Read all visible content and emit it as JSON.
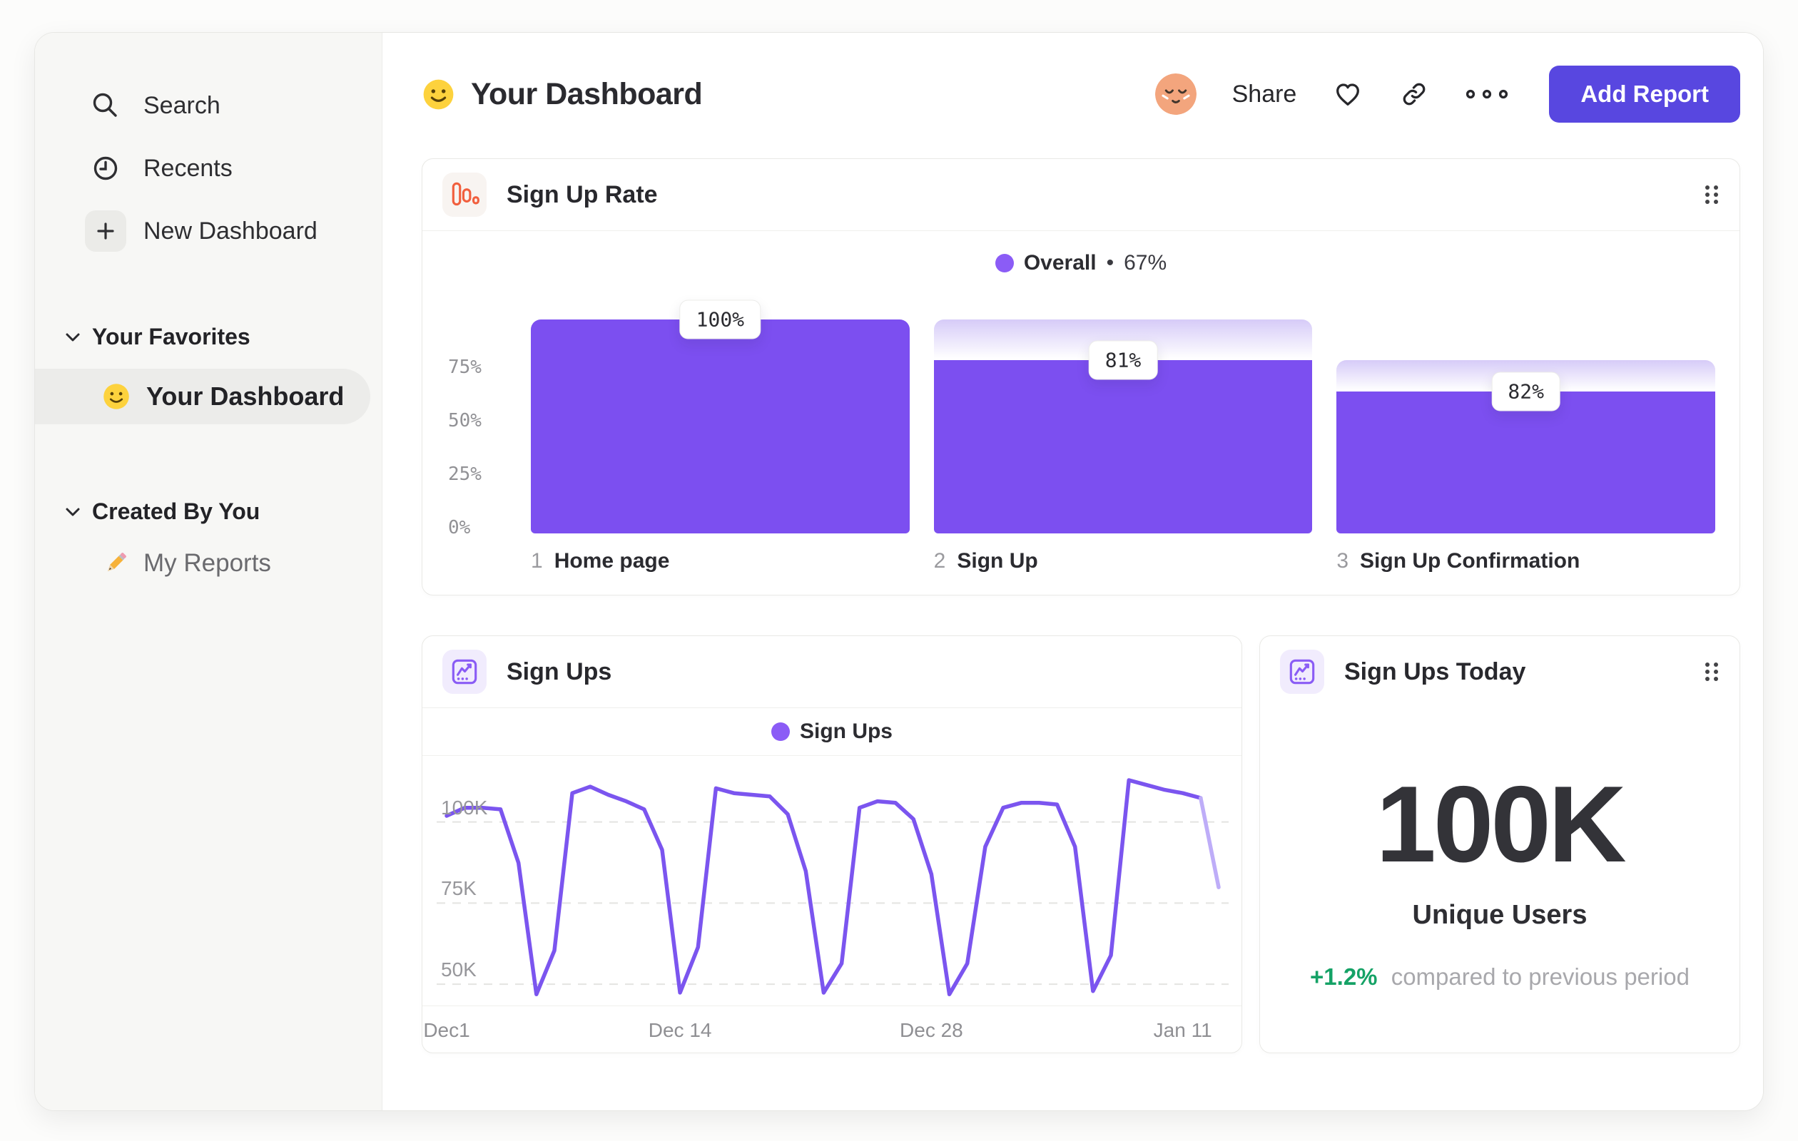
{
  "sidebar": {
    "items": [
      {
        "label": "Search",
        "icon": "search-icon"
      },
      {
        "label": "Recents",
        "icon": "clock-icon"
      },
      {
        "label": "New Dashboard",
        "icon": "plus-icon"
      }
    ],
    "sections": [
      {
        "title": "Your Favorites",
        "items": [
          {
            "label": "Your Dashboard",
            "icon": "smiley-emoji",
            "active": true
          }
        ]
      },
      {
        "title": "Created By You",
        "items": [
          {
            "label": "My Reports",
            "icon": "pencil-emoji",
            "active": false
          }
        ]
      }
    ]
  },
  "header": {
    "emoji": "smiley-emoji",
    "title": "Your Dashboard",
    "share_label": "Share",
    "add_report_label": "Add Report",
    "icons": [
      "avatar",
      "heart-icon",
      "link-icon",
      "ellipsis-icon"
    ]
  },
  "cards": {
    "signup_rate": {
      "title": "Sign Up Rate",
      "icon": "bar-chart-icon",
      "legend_label": "Overall",
      "legend_separator": "•",
      "legend_value": "67%"
    },
    "signups": {
      "title": "Sign Ups",
      "icon": "line-chart-icon",
      "legend_label": "Sign Ups"
    },
    "signups_today": {
      "title": "Sign Ups Today",
      "icon": "line-chart-icon",
      "value": "100K",
      "value_label": "Unique Users",
      "delta": "+1.2%",
      "comparison": "compared to previous period"
    }
  },
  "chart_data": [
    {
      "type": "bar",
      "subtype": "funnel",
      "title": "Sign Up Rate",
      "legend": [
        "Overall"
      ],
      "overall_value": "67%",
      "ylim": [
        0,
        100
      ],
      "y_ticks": [
        "75%",
        "50%",
        "25%",
        "0%"
      ],
      "grid": false,
      "steps": [
        {
          "step": "1",
          "label": "Home page",
          "badge": "100%",
          "conversion_from_previous_pct": 100,
          "cumulative_pct": 100
        },
        {
          "step": "2",
          "label": "Sign Up",
          "badge": "81%",
          "conversion_from_previous_pct": 81,
          "cumulative_pct": 81
        },
        {
          "step": "3",
          "label": "Sign Up Confirmation",
          "badge": "82%",
          "conversion_from_previous_pct": 82,
          "cumulative_pct": 66.4
        }
      ],
      "bar_color": "#7c4ff0",
      "dropoff_gradient_top": "#d6cbf8"
    },
    {
      "type": "line",
      "title": "Sign Ups",
      "legend": [
        "Sign Ups"
      ],
      "legend_position": "top-center",
      "grid": "dashed-horizontal",
      "ylim": [
        40,
        110
      ],
      "y_unit": "K",
      "y_ticks": [
        {
          "label": "100K",
          "value": 100
        },
        {
          "label": "75K",
          "value": 75
        },
        {
          "label": "50K",
          "value": 50
        }
      ],
      "x_ticks": [
        {
          "label": "Dec1",
          "index": 0
        },
        {
          "label": "Dec 14",
          "index": 13
        },
        {
          "label": "Dec 28",
          "index": 27
        },
        {
          "label": "Jan 11",
          "index": 41
        }
      ],
      "values": [
        97.5,
        100,
        100,
        99.5,
        83,
        42.5,
        56,
        104.5,
        106.5,
        104,
        102,
        99.5,
        87,
        43,
        57,
        106,
        104.5,
        104,
        103.5,
        98,
        80.5,
        43,
        52,
        100,
        102,
        101.5,
        96.5,
        79.5,
        42.5,
        52,
        88,
        100,
        101.5,
        101.5,
        101,
        88,
        43.5,
        54.5,
        108.5,
        107,
        105.5,
        104.5,
        103,
        75.5
      ],
      "faded_tail_points": 2,
      "line_color": "#7b55ef",
      "faded_color": "#beadf8"
    }
  ],
  "colors": {
    "accent": "#5847e0",
    "purple": "#7c4ff0",
    "legend_dot": "#8b5cf6",
    "green": "#15a266",
    "text_dark": "#2c2c31",
    "text_gray": "#97979b",
    "sidebar_bg": "#f7f7f5",
    "card_border": "#e9e9e6",
    "orange_icon": "#f15f3e"
  }
}
